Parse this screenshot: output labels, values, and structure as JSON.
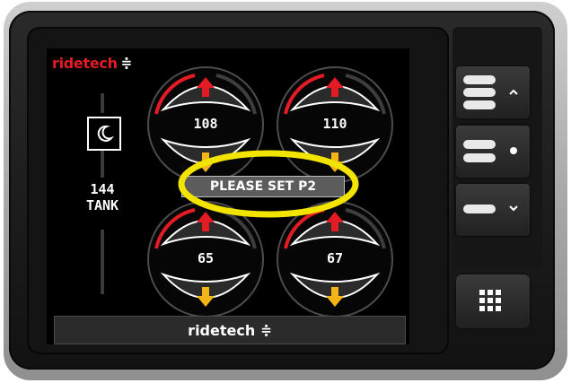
{
  "brand": {
    "name": "ridetech",
    "mark": "≑"
  },
  "tank": {
    "value": "144",
    "label": "TANK",
    "mode_icon": "moon-icon"
  },
  "gauges": [
    {
      "id": "front-left",
      "value": "108"
    },
    {
      "id": "front-right",
      "value": "110"
    },
    {
      "id": "rear-left",
      "value": "65"
    },
    {
      "id": "rear-right",
      "value": "67"
    }
  ],
  "message": "PLEASE SET P2",
  "footer": {
    "brand": "ridetech",
    "mark": "≑"
  },
  "buttons": [
    {
      "name": "preset-up-button",
      "icon": "chevron-up-icon"
    },
    {
      "name": "preset-select-button",
      "icon": "dot-icon"
    },
    {
      "name": "preset-down-button",
      "icon": "chevron-down-icon"
    },
    {
      "name": "menu-button",
      "icon": "grid-icon"
    }
  ],
  "colors": {
    "brand_red": "#e31b23",
    "up_arrow": "#e31b23",
    "down_arrow": "#f2b417",
    "highlight": "#f3e400"
  }
}
